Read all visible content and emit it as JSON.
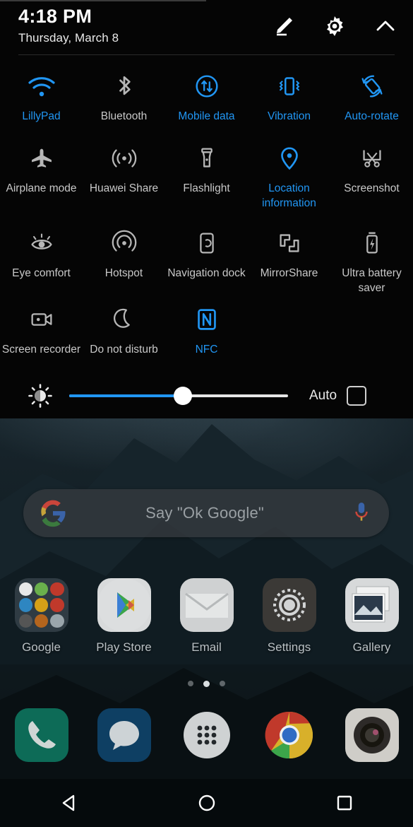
{
  "status_bar": {
    "time": "4:18 PM",
    "date": "Thursday, March 8"
  },
  "quick_settings": {
    "header_actions": [
      {
        "name": "edit-icon",
        "label": "Edit"
      },
      {
        "name": "gear-icon",
        "label": "Settings"
      },
      {
        "name": "chevron-up-icon",
        "label": "Collapse"
      }
    ],
    "active_color": "#2196f3",
    "inactive_color": "#c8c8c8",
    "tiles": [
      {
        "label": "LillyPad",
        "icon": "wifi-icon",
        "state": "on"
      },
      {
        "label": "Bluetooth",
        "icon": "bluetooth-icon",
        "state": "off"
      },
      {
        "label": "Mobile data",
        "icon": "mobile-data-icon",
        "state": "on"
      },
      {
        "label": "Vibration",
        "icon": "vibration-icon",
        "state": "on"
      },
      {
        "label": "Auto-rotate",
        "icon": "auto-rotate-icon",
        "state": "on"
      },
      {
        "label": "Airplane mode",
        "icon": "airplane-icon",
        "state": "off"
      },
      {
        "label": "Huawei Share",
        "icon": "huawei-share-icon",
        "state": "off"
      },
      {
        "label": "Flashlight",
        "icon": "flashlight-icon",
        "state": "off"
      },
      {
        "label": "Location information",
        "icon": "location-pin-icon",
        "state": "on"
      },
      {
        "label": "Screenshot",
        "icon": "screenshot-icon",
        "state": "off"
      },
      {
        "label": "Eye comfort",
        "icon": "eye-comfort-icon",
        "state": "off"
      },
      {
        "label": "Hotspot",
        "icon": "hotspot-icon",
        "state": "off"
      },
      {
        "label": "Navigation dock",
        "icon": "navigation-dock-icon",
        "state": "off"
      },
      {
        "label": "MirrorShare",
        "icon": "mirror-share-icon",
        "state": "off"
      },
      {
        "label": "Ultra battery saver",
        "icon": "battery-saver-icon",
        "state": "off"
      },
      {
        "label": "Screen recorder",
        "icon": "screen-recorder-icon",
        "state": "off"
      },
      {
        "label": "Do not disturb",
        "icon": "moon-icon",
        "state": "off"
      },
      {
        "label": "NFC",
        "icon": "nfc-icon",
        "state": "on"
      }
    ],
    "brightness": {
      "icon": "brightness-icon",
      "value_percent": 52,
      "auto_label": "Auto",
      "auto_checked": false
    }
  },
  "home_screen": {
    "search": {
      "placeholder": "Say \"Ok Google\"",
      "value": "",
      "logo_icon": "google-g-icon",
      "mic_icon": "microphone-icon"
    },
    "apps": [
      {
        "label": "Google",
        "icon": "google-folder-icon"
      },
      {
        "label": "Play Store",
        "icon": "play-store-icon"
      },
      {
        "label": "Email",
        "icon": "email-icon"
      },
      {
        "label": "Settings",
        "icon": "settings-icon"
      },
      {
        "label": "Gallery",
        "icon": "gallery-icon"
      }
    ],
    "page_indicator": {
      "count": 3,
      "active_index": 1
    },
    "dock": [
      {
        "label": "Phone",
        "icon": "phone-icon"
      },
      {
        "label": "Messages",
        "icon": "messages-icon"
      },
      {
        "label": "App drawer",
        "icon": "app-drawer-icon"
      },
      {
        "label": "Chrome",
        "icon": "chrome-icon"
      },
      {
        "label": "Camera",
        "icon": "camera-icon"
      }
    ]
  },
  "navigation_bar": [
    {
      "label": "Back",
      "icon": "back-triangle-icon"
    },
    {
      "label": "Home",
      "icon": "home-circle-icon"
    },
    {
      "label": "Recents",
      "icon": "recents-square-icon"
    }
  ]
}
